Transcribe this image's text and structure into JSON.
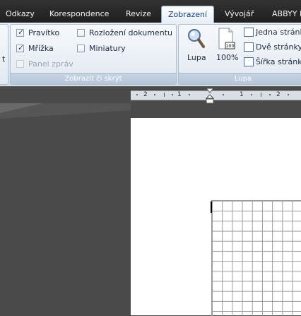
{
  "tabs": [
    {
      "label": "Odkazy",
      "active": false
    },
    {
      "label": "Korespondence",
      "active": false
    },
    {
      "label": "Revize",
      "active": false
    },
    {
      "label": "Zobrazení",
      "active": true
    },
    {
      "label": "Vývojář",
      "active": false
    },
    {
      "label": "ABBYY F",
      "active": false
    }
  ],
  "ribbon": {
    "left_stub_label": "t",
    "show_group": {
      "label": "Zobrazit či skrýt",
      "items": [
        {
          "label": "Pravítko",
          "checked": true,
          "enabled": true
        },
        {
          "label": "Rozložení dokumentu",
          "checked": false,
          "enabled": true
        },
        {
          "label": "Mřížka",
          "checked": true,
          "enabled": true
        },
        {
          "label": "Miniatury",
          "checked": false,
          "enabled": true
        },
        {
          "label": "Panel zpráv",
          "checked": false,
          "enabled": false
        }
      ]
    },
    "zoom_group": {
      "label": "Lupa",
      "zoom_button": "Lupa",
      "percent_button": "100%",
      "percent_icon_text": "100",
      "one_page": "Jedna stránk",
      "two_pages": "Dvě stránky",
      "page_width": "Šířka stránky"
    }
  },
  "ruler": {
    "labels": [
      "2",
      "1",
      "1",
      "2"
    ]
  },
  "colors": {
    "tab_bar": "#2a2a2a",
    "ribbon": "#e3e9f1",
    "workspace": "#4a4a4a",
    "page": "#ffffff",
    "grid_lines": "#9b9b9b"
  }
}
